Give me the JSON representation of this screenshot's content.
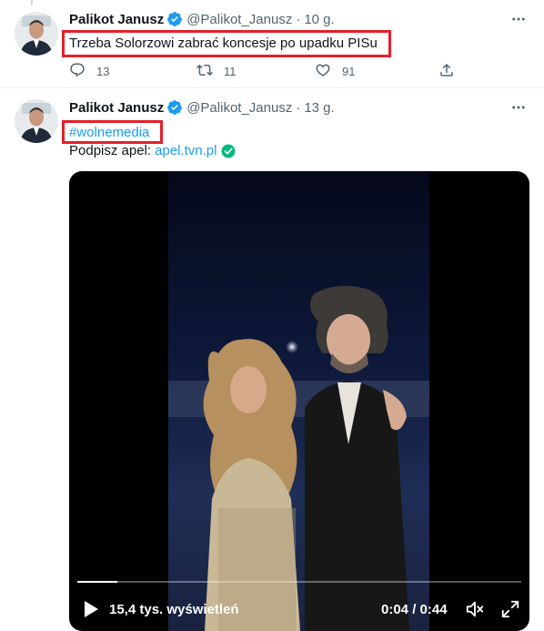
{
  "tweets": [
    {
      "author_name": "Palikot Janusz",
      "handle": "@Palikot_Janusz",
      "separator": "·",
      "time": "10 g.",
      "text": "Trzeba Solorzowi zabrać koncesje po upadku PISu",
      "counts": {
        "reply": "13",
        "retweet": "11",
        "like": "91"
      }
    },
    {
      "author_name": "Palikot Janusz",
      "handle": "@Palikot_Janusz",
      "separator": "·",
      "time": "13 g.",
      "hashtag": "#wolnemedia",
      "petition_label": "Podpisz apel:",
      "petition_link": "apel.tvn.pl",
      "video": {
        "views": "15,4 tys. wyświetleń",
        "duration": "0:04 / 0:44",
        "progress": 0.09
      }
    }
  ],
  "icons": {
    "verified": "verified-badge-icon",
    "more": "more-icon",
    "reply": "reply-icon",
    "retweet": "retweet-icon",
    "like": "like-icon",
    "share": "share-icon",
    "play": "play-icon",
    "mute": "volume-icon",
    "fullscreen": "fullscreen-icon",
    "petition_check": "check-circle-icon"
  },
  "colors": {
    "accent": "#1d9bf0",
    "highlight_box": "#e4202b",
    "check_green": "#00ba7c",
    "secondary_text": "#536471"
  }
}
